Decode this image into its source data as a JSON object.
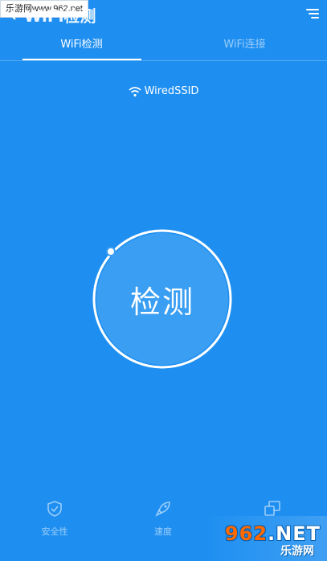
{
  "header": {
    "app_title": "WiFi检测"
  },
  "watermark_top": "乐游网www.962.net",
  "tabs": [
    {
      "label": "WiFi检测",
      "active": true
    },
    {
      "label": "WiFi连接",
      "active": false
    }
  ],
  "network": {
    "ssid": "WiredSSID"
  },
  "detect": {
    "button_label": "检测"
  },
  "bottom_nav": [
    {
      "label": "安全性",
      "icon": "shield-check-icon"
    },
    {
      "label": "速度",
      "icon": "rocket-icon"
    },
    {
      "label": "",
      "icon": "devices-icon"
    }
  ],
  "watermark_bottom": {
    "logo_num": "962",
    "logo_text": ".NET",
    "sub": "乐游网"
  },
  "colors": {
    "background": "#1e8ff1",
    "button": "#3a9ef3",
    "text": "#ffffff"
  }
}
